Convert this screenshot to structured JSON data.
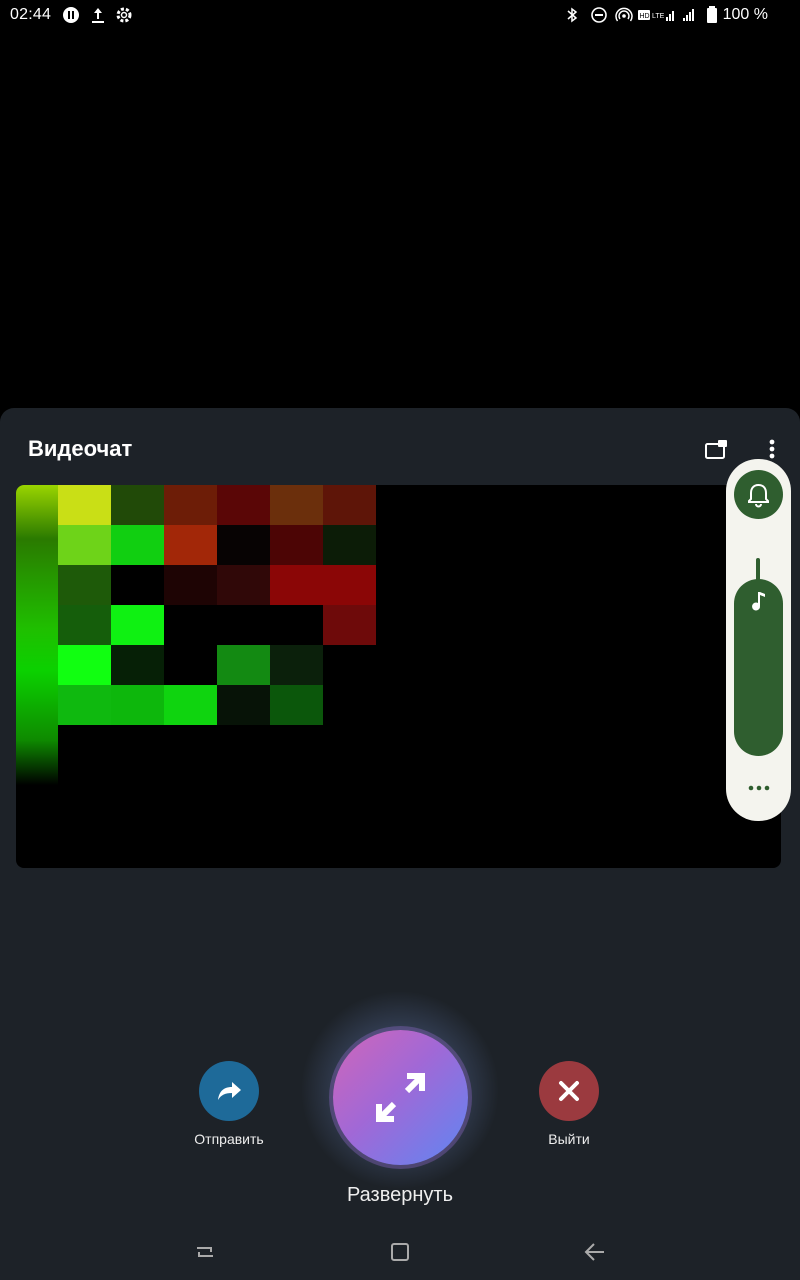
{
  "status_bar": {
    "time": "02:44",
    "battery_text": "100 %",
    "icons": [
      "pause-circle-icon",
      "upload-icon",
      "gear-icon",
      "bluetooth-icon",
      "do-not-disturb-icon",
      "hotspot-icon",
      "hd-icon",
      "lte-icon",
      "signal-icon",
      "signal-icon",
      "battery-icon"
    ]
  },
  "sheet": {
    "title": "Видеочат",
    "icons": [
      "picture-in-picture-icon",
      "more-vertical-icon"
    ]
  },
  "video_preview": {
    "colors": {
      "row0": [
        "#c9df16",
        "#214a08",
        "#6d1d07",
        "#5a0606",
        "#6b2f0c",
        "#5e1508"
      ],
      "row1": [
        "#6ed319",
        "#11cf11",
        "#a22708",
        "#070303",
        "#4c0505",
        "#0c1c07"
      ],
      "row2": [
        "#1e5a09",
        "#000000",
        "#1e0404",
        "#300808",
        "#8b0606",
        "#8b0606"
      ],
      "row3": [
        "#155e0b",
        "#0ff112",
        "#000000",
        "#000000",
        "#000000",
        "#6e0a0a"
      ],
      "row4": [
        "#11ff11",
        "#062006",
        "#000000",
        "#138a12",
        "#0b200b",
        "#000000"
      ],
      "row5": [
        "#0fb90f",
        "#0db70c",
        "#0fd40f",
        "#071307",
        "#0b570b",
        "#000000"
      ]
    }
  },
  "volume_panel": {
    "icons": [
      "bell-icon",
      "music-note-icon",
      "more-horizontal-icon"
    ],
    "media_level_percent": 100,
    "accent_color": "#2f5e2f"
  },
  "controls": {
    "share_label": "Отправить",
    "expand_label": "Развернуть",
    "exit_label": "Выйти",
    "share_color": "#1e6a99",
    "exit_color": "#9b3a3f"
  },
  "nav_bar": {
    "icons": [
      "recent-apps-icon",
      "home-icon",
      "back-icon"
    ]
  }
}
